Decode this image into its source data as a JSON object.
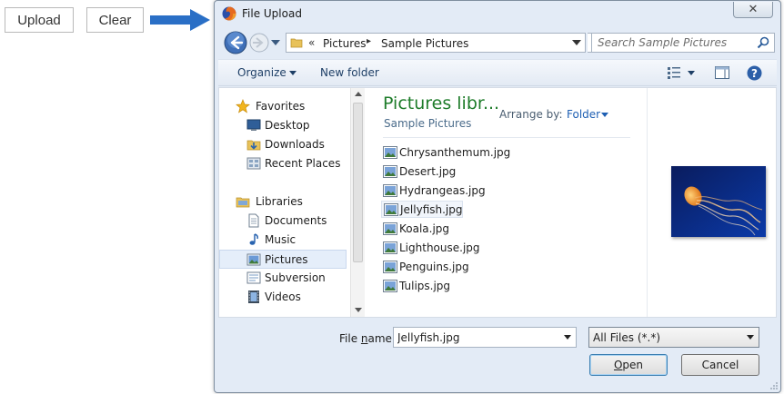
{
  "page": {
    "upload_label": "Upload",
    "clear_label": "Clear"
  },
  "dialog": {
    "title": "File Upload",
    "close_label": "✕",
    "address": {
      "separator": "«",
      "crumbs": [
        "Pictures",
        "Sample Pictures"
      ],
      "crumb_arrow": "▸"
    },
    "search": {
      "placeholder": "Search Sample Pictures"
    },
    "toolbar": {
      "organize_label": "Organize",
      "new_folder_label": "New folder"
    },
    "nav": {
      "items": [
        {
          "label": "Favorites",
          "icon": "star-icon"
        },
        {
          "label": "Desktop",
          "icon": "desktop-icon"
        },
        {
          "label": "Downloads",
          "icon": "downloads-icon"
        },
        {
          "label": "Recent Places",
          "icon": "recent-places-icon"
        },
        {
          "label": "Libraries",
          "icon": "libraries-icon"
        },
        {
          "label": "Documents",
          "icon": "documents-icon"
        },
        {
          "label": "Music",
          "icon": "music-icon"
        },
        {
          "label": "Pictures",
          "icon": "pictures-icon"
        },
        {
          "label": "Subversion",
          "icon": "subversion-icon"
        },
        {
          "label": "Videos",
          "icon": "videos-icon"
        }
      ],
      "selected": "Pictures"
    },
    "library": {
      "title": "Pictures libr...",
      "subtitle": "Sample Pictures",
      "arrange_label": "Arrange by:",
      "arrange_value": "Folder"
    },
    "files": [
      "Chrysanthemum.jpg",
      "Desert.jpg",
      "Hydrangeas.jpg",
      "Jellyfish.jpg",
      "Koala.jpg",
      "Lighthouse.jpg",
      "Penguins.jpg",
      "Tulips.jpg"
    ],
    "selected_file": "Jellyfish.jpg",
    "filename": {
      "label_prefix": "File ",
      "label_underlined": "n",
      "label_suffix": "ame:",
      "value": "Jellyfish.jpg"
    },
    "filetype_value": "All Files (*.*)",
    "open_label_underlined": "O",
    "open_label_rest": "pen",
    "cancel_label": "Cancel"
  },
  "colors": {
    "arrow": "#2a6fc6",
    "library_title": "#1e7c2a",
    "link": "#1e5fb3",
    "dialog_bg": "#e3ebf6"
  }
}
